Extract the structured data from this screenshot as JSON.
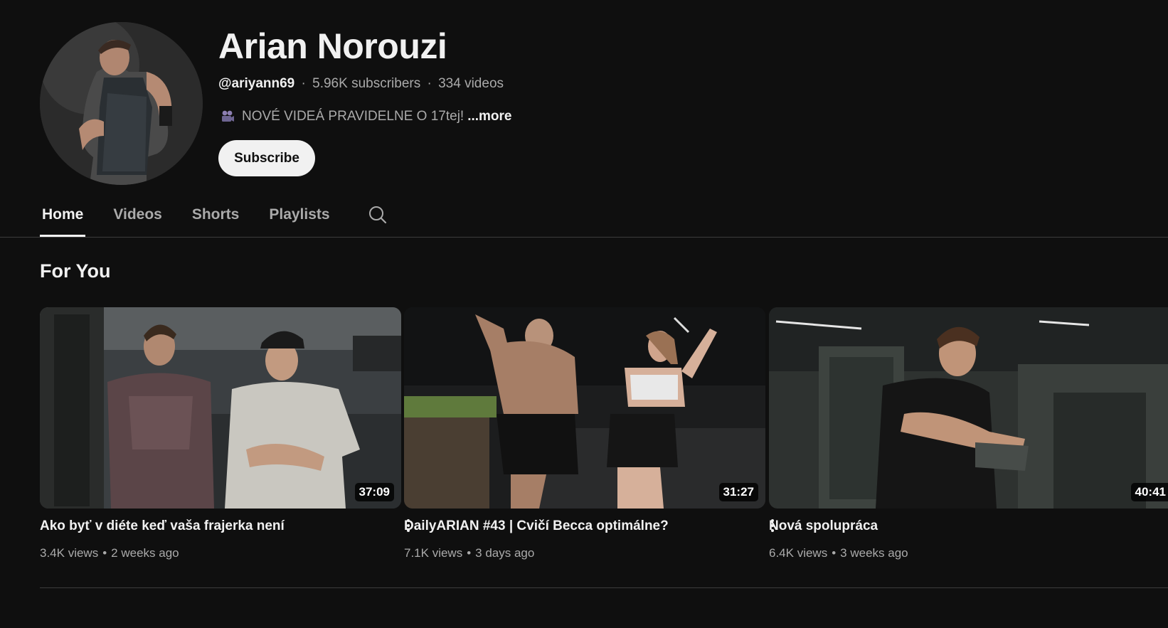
{
  "channel": {
    "name": "Arian Norouzi",
    "handle": "@ariyann69",
    "subscribers": "5.96K subscribers",
    "videos": "334 videos",
    "separator": "·",
    "description": "NOVÉ VIDEÁ PRAVIDELNE O 17tej!",
    "more_label": "...more",
    "subscribe_label": "Subscribe"
  },
  "tabs": [
    {
      "label": "Home",
      "active": true
    },
    {
      "label": "Videos",
      "active": false
    },
    {
      "label": "Shorts",
      "active": false
    },
    {
      "label": "Playlists",
      "active": false
    }
  ],
  "section": {
    "title": "For You",
    "videos": [
      {
        "title": "Ako byť v diéte keď vaša frajerka není",
        "views": "3.4K views",
        "age": "2 weeks ago",
        "duration": "37:09"
      },
      {
        "title": "DailyARIAN #43 | Cvičí Becca optimálne?",
        "views": "7.1K views",
        "age": "3 days ago",
        "duration": "31:27"
      },
      {
        "title": "Nová spolupráca",
        "views": "6.4K views",
        "age": "3 weeks ago",
        "duration": "40:41"
      }
    ]
  },
  "colors": {
    "background": "#0f0f0f",
    "text_primary": "#f1f1f1",
    "text_secondary": "#aaaaaa",
    "subscribe_bg": "#f1f1f1",
    "divider": "#3d3d3d"
  },
  "icons": {
    "search": "search-icon",
    "description": "movie-camera-icon",
    "video_menu": "more-vert-icon"
  }
}
